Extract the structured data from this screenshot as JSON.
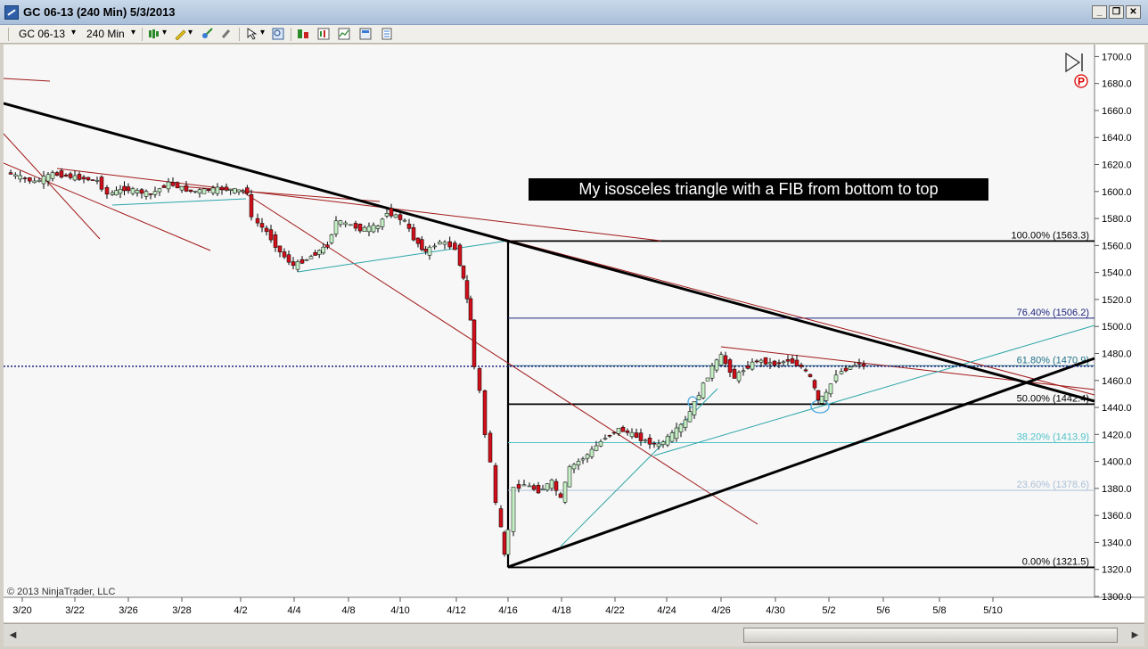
{
  "window": {
    "title": "GC 06-13 (240 Min)  5/3/2013",
    "btn_minimize": "_",
    "btn_restore": "❐",
    "btn_close": "✕"
  },
  "toolbar": {
    "instrument": "GC 06-13",
    "interval": "240 Min",
    "dropdown_arrow": "▾"
  },
  "chart": {
    "annotation": "My isosceles triangle with a FIB from bottom to top",
    "copyright": "© 2013 NinjaTrader, LLC",
    "price_ticks": [
      "1700.0",
      "1680.0",
      "1660.0",
      "1640.0",
      "1620.0",
      "1600.0",
      "1580.0",
      "1560.0",
      "1540.0",
      "1520.0",
      "1500.0",
      "1480.0",
      "1460.0",
      "1440.0",
      "1420.0",
      "1400.0",
      "1380.0",
      "1360.0",
      "1340.0",
      "1320.0",
      "1300.0"
    ],
    "date_ticks": [
      "3/20",
      "3/22",
      "3/26",
      "3/28",
      "4/2",
      "4/4",
      "4/8",
      "4/10",
      "4/12",
      "4/16",
      "4/18",
      "4/22",
      "4/24",
      "4/26",
      "4/30",
      "5/2",
      "5/6",
      "5/8",
      "5/10"
    ],
    "fib_levels": [
      {
        "label": "100.00% (1563.3)",
        "value": 1563.3,
        "color": "#000000"
      },
      {
        "label": "76.40% (1506.2)",
        "value": 1506.2,
        "color": "#1a237e"
      },
      {
        "label": "61.80% (1470.9)",
        "value": 1470.9,
        "color": "#1d6f86"
      },
      {
        "label": "50.00% (1442.4)",
        "value": 1442.4,
        "color": "#000000"
      },
      {
        "label": "38.20% (1413.9)",
        "value": 1413.9,
        "color": "#4fc3c8"
      },
      {
        "label": "23.60% (1378.6)",
        "value": 1378.6,
        "color": "#a9bfd6"
      },
      {
        "label": "0.00% (1321.5)",
        "value": 1321.5,
        "color": "#000000"
      }
    ],
    "current_price": 1470.5,
    "colors": {
      "bull": "#c5efc5",
      "bear": "#d0101a",
      "trend": "#000000",
      "resistance": "#a11818",
      "channel": "#2aa5a8",
      "background": "#f7f7f7"
    },
    "icons": {
      "play": "play-end-icon",
      "p_marker": "p-marker-icon"
    }
  }
}
